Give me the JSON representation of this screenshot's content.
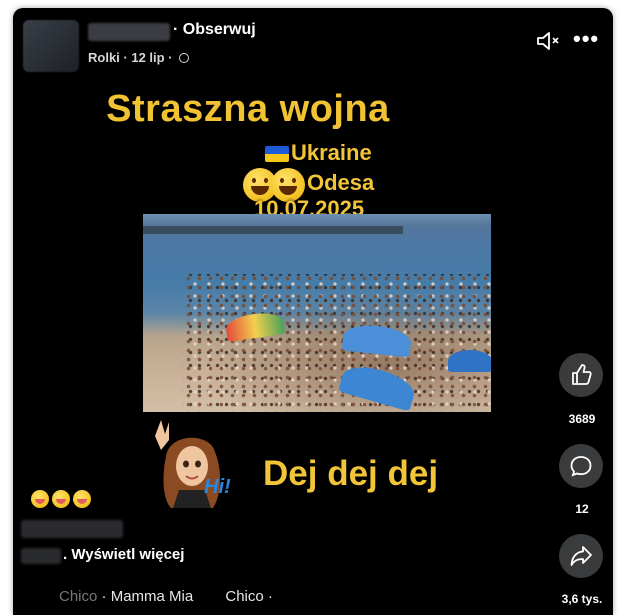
{
  "header": {
    "follow_label": "· Obserwuj",
    "meta": "Rolki · 12 lip ·",
    "more_label": "•••"
  },
  "video": {
    "title": "Straszna wojna",
    "country": "Ukraine",
    "city": "Odesa",
    "date": "10.07.2025",
    "sticker_text": "Hi!",
    "caption": "Dej dej dej"
  },
  "actions": {
    "like_count": "3689",
    "comment_count": "12",
    "share_count": "3,6 tys."
  },
  "description": {
    "see_more": ". Wyświetl więcej"
  },
  "music": {
    "lead_fade": "Chico",
    "track": "· Mamma Mia",
    "artist": "Chico ·"
  },
  "colors": {
    "overlay_text": "#f2c438",
    "background": "#000000",
    "button_bg": "#3a3b3c"
  },
  "icons": [
    "muted-speaker-icon",
    "more-options-icon",
    "globe-icon",
    "ukraine-flag-icon",
    "like-icon",
    "comment-icon",
    "share-icon"
  ]
}
